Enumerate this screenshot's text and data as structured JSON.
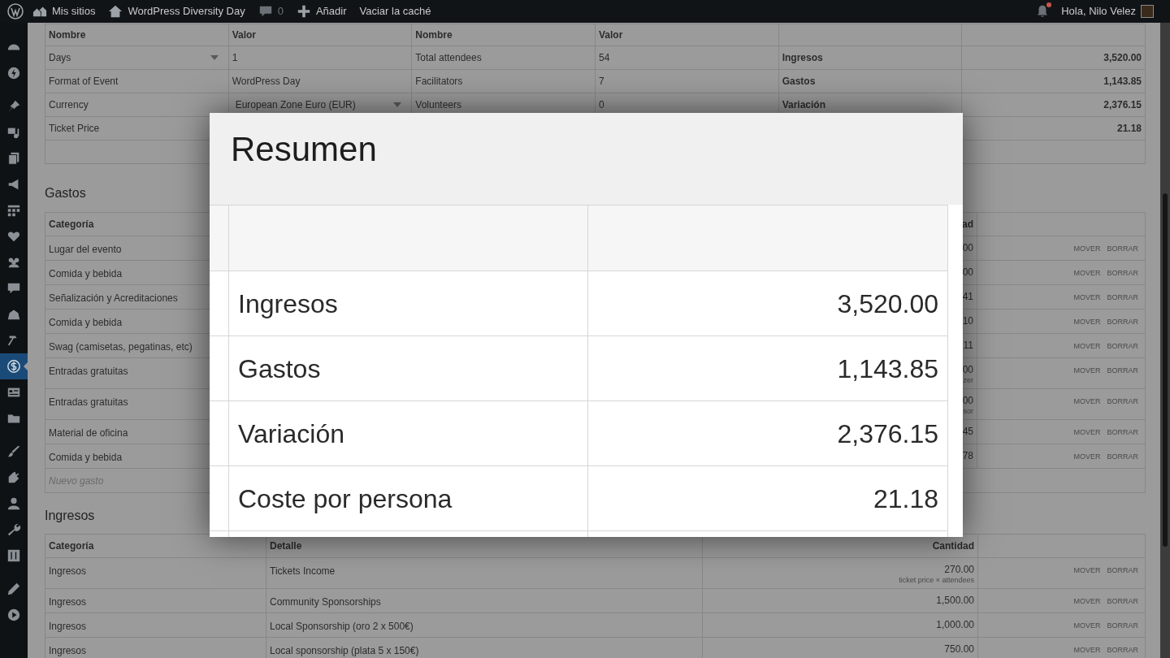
{
  "admin_bar": {
    "sites": "Mis sitios",
    "site": "WordPress Diversity Day",
    "comments": "0",
    "new": "Añadir",
    "cache": "Vaciar la caché",
    "greeting": "Hola, Nilo Velez",
    "unread_notifications": true
  },
  "sidebar": {
    "groups": [
      [
        {
          "selected": false
        },
        {
          "selected": false
        }
      ],
      [
        {
          "selected": false
        },
        {
          "selected": false
        },
        {
          "selected": false
        },
        {
          "selected": false
        },
        {
          "selected": false
        },
        {
          "selected": false
        },
        {
          "selected": false
        },
        {
          "selected": false
        },
        {
          "selected": false
        },
        {
          "selected": false
        },
        {
          "selected": true
        },
        {
          "selected": false
        },
        {
          "selected": false
        }
      ],
      [
        {
          "selected": false
        },
        {
          "selected": false
        },
        {
          "selected": false
        },
        {
          "selected": false
        },
        {
          "selected": false
        }
      ],
      [
        {
          "selected": false
        },
        {
          "selected": false
        }
      ]
    ]
  },
  "settings_table": {
    "columns": [
      "Nombre",
      "Valor",
      "Nombre",
      "Valor"
    ],
    "rows": [
      {
        "name": "Days",
        "name_dropdown": true,
        "value": "1",
        "name_2": "Total attendees",
        "value_2": "54",
        "summary_label": "Ingresos",
        "summary_value": "3,520.00"
      },
      {
        "name": "Format of Event",
        "value": "WordPress Day",
        "name_2": "Facilitators",
        "value_2": "7",
        "summary_label": "Gastos",
        "summary_value": "1,143.85"
      },
      {
        "name": "Currency",
        "value": "European Zone Euro (EUR)",
        "value_dropdown": true,
        "name_2": "Volunteers",
        "value_2": "0",
        "summary_label": "Variación",
        "summary_value": "2,376.15"
      },
      {
        "name": "Ticket Price",
        "summary_value": "21.18"
      },
      {}
    ]
  },
  "expenses": {
    "heading": "Gastos",
    "columns": [
      "Categoría",
      "ad"
    ],
    "rows": [
      {
        "category": "Lugar del evento",
        "amount": "00",
        "actions": [
          "MOVER",
          "BORRAR"
        ]
      },
      {
        "category": "Comida y bebida",
        "amount": "00",
        "actions": [
          "MOVER",
          "BORRAR"
        ]
      },
      {
        "category": "Señalización y Acreditaciones",
        "amount": "41",
        "actions": [
          "MOVER",
          "BORRAR"
        ]
      },
      {
        "category": "Comida y bebida",
        "amount": "10",
        "actions": [
          "MOVER",
          "BORRAR"
        ]
      },
      {
        "category": "Swag (camisetas, pegatinas, etc)",
        "amount": "11",
        "actions": [
          "MOVER",
          "BORRAR"
        ]
      },
      {
        "category": "Entradas gratuitas",
        "amount": "00",
        "note": "zer",
        "actions": [
          "MOVER",
          "BORRAR"
        ]
      },
      {
        "category": "Entradas gratuitas",
        "amount": "00",
        "note": "sor",
        "actions": [
          "MOVER",
          "BORRAR"
        ]
      },
      {
        "category": "Material de oficina",
        "amount": "45",
        "actions": [
          "MOVER",
          "BORRAR"
        ]
      },
      {
        "category": "Comida y bebida",
        "amount": "78",
        "actions": [
          "MOVER",
          "BORRAR"
        ]
      }
    ],
    "new_row_placeholder": "Nuevo gasto"
  },
  "income": {
    "heading": "Ingresos",
    "columns": [
      "Categoría",
      "Detalle",
      "Cantidad"
    ],
    "rows": [
      {
        "category": "Ingresos",
        "detail": "Tickets Income",
        "amount": "270.00",
        "note": "ticket price × attendees",
        "actions": [
          "MOVER",
          "BORRAR"
        ]
      },
      {
        "category": "Ingresos",
        "detail": "Community Sponsorships",
        "amount": "1,500.00",
        "actions": [
          "MOVER",
          "BORRAR"
        ]
      },
      {
        "category": "Ingresos",
        "detail": "Local Sponsorship (oro 2 x 500€)",
        "amount": "1,000.00",
        "actions": [
          "MOVER",
          "BORRAR"
        ]
      },
      {
        "category": "Ingresos",
        "detail": "Local sponsorship (plata 5 x 150€)",
        "amount": "750.00",
        "actions": [
          "MOVER",
          "BORRAR"
        ]
      }
    ]
  },
  "popup": {
    "title": "Resumen",
    "rows": [
      {
        "label": "Ingresos",
        "value": "3,520.00"
      },
      {
        "label": "Gastos",
        "value": "1,143.85"
      },
      {
        "label": "Variación",
        "value": "2,376.15"
      },
      {
        "label": "Coste por persona",
        "value": "21.18"
      }
    ]
  }
}
